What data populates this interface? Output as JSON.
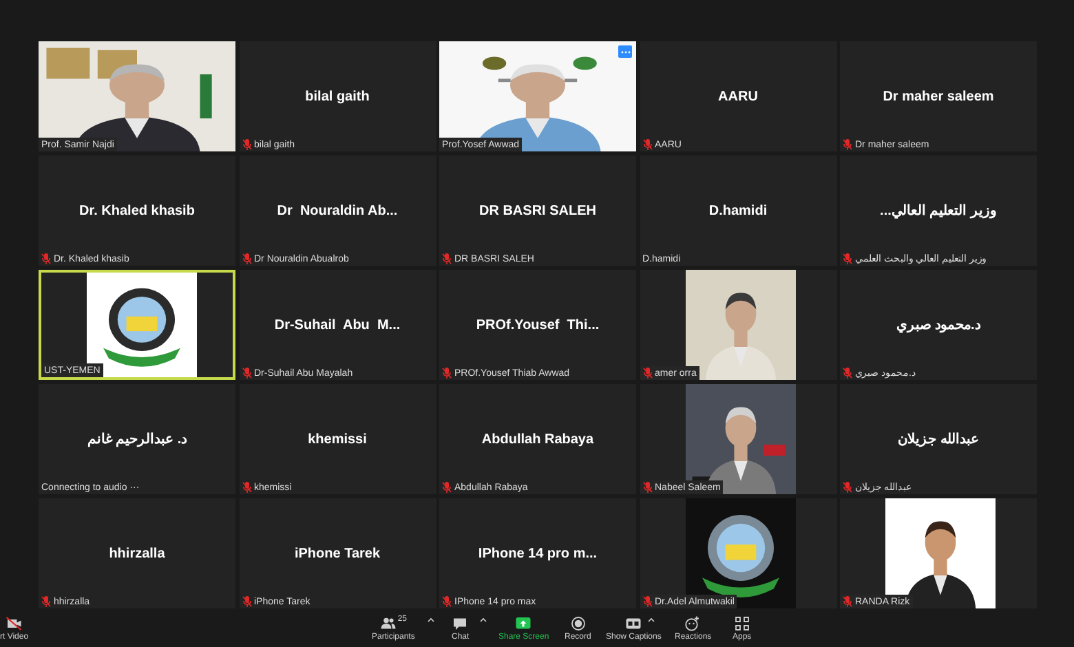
{
  "tiles": [
    {
      "kind": "video",
      "label": "Prof. Samir Najdi",
      "muted": false,
      "speaking": false
    },
    {
      "kind": "name",
      "display_name": "bilal gaith",
      "label": "bilal gaith",
      "muted": true,
      "speaking": false
    },
    {
      "kind": "video",
      "label": "Prof.Yosef Awwad",
      "muted": false,
      "speaking": false,
      "more_button": true
    },
    {
      "kind": "name",
      "display_name": "AARU",
      "label": "AARU",
      "muted": true,
      "speaking": false
    },
    {
      "kind": "name",
      "display_name": "Dr maher saleem",
      "label": "Dr maher saleem",
      "muted": true,
      "speaking": false
    },
    {
      "kind": "name",
      "display_name": "Dr. Khaled khasib",
      "label": "Dr. Khaled khasib",
      "muted": true,
      "speaking": false
    },
    {
      "kind": "name",
      "display_name": "Dr  Nouraldin Ab...",
      "label": "Dr Nouraldin Abualrob",
      "muted": true,
      "speaking": false
    },
    {
      "kind": "name",
      "display_name": "DR BASRI SALEH",
      "label": "DR BASRI SALEH",
      "muted": true,
      "speaking": false
    },
    {
      "kind": "name",
      "display_name": "D.hamidi",
      "label": "D.hamidi",
      "muted": false,
      "speaking": false
    },
    {
      "kind": "name",
      "display_name": "وزير التعليم العالي...",
      "label": "وزير التعليم العالي والبحث العلمي",
      "muted": true,
      "speaking": false
    },
    {
      "label": "UST-YEMEN",
      "muted": false,
      "speaking": true
    },
    {
      "kind": "name",
      "display_name": "Dr-Suhail  Abu  M...",
      "label": "Dr-Suhail Abu Mayalah",
      "muted": true,
      "speaking": false
    },
    {
      "kind": "name",
      "display_name": "PROf.Yousef  Thi...",
      "label": "PROf.Yousef Thiab Awwad",
      "muted": true,
      "speaking": false
    },
    {
      "label": "amer orra",
      "muted": true,
      "speaking": false
    },
    {
      "kind": "name",
      "display_name": "د.محمود صبري",
      "label": "د.محمود صبري",
      "muted": true,
      "speaking": false
    },
    {
      "kind": "name",
      "display_name": "د. عبدالرحيم غانم",
      "label": "Connecting to audio ···",
      "muted": false,
      "speaking": false
    },
    {
      "kind": "name",
      "display_name": "khemissi",
      "label": "khemissi",
      "muted": true,
      "speaking": false
    },
    {
      "kind": "name",
      "display_name": "Abdullah Rabaya",
      "label": "Abdullah Rabaya",
      "muted": true,
      "speaking": false
    },
    {
      "label": "Nabeel Saleem",
      "muted": true,
      "speaking": false
    },
    {
      "kind": "name",
      "display_name": "عبدالله جزيلان",
      "label": "عبدالله جزيلان",
      "muted": true,
      "speaking": false
    },
    {
      "kind": "name",
      "display_name": "hhirzalla",
      "label": "hhirzalla",
      "muted": true,
      "speaking": false
    },
    {
      "kind": "name",
      "display_name": "iPhone Tarek",
      "label": "iPhone Tarek",
      "muted": true,
      "speaking": false
    },
    {
      "kind": "name",
      "display_name": "IPhone 14 pro m...",
      "label": "IPhone 14 pro max",
      "muted": true,
      "speaking": false
    },
    {
      "label": "Dr.Adel Almutwakil",
      "muted": true,
      "speaking": false
    },
    {
      "label": "RANDA Rizk",
      "muted": true,
      "speaking": false
    }
  ],
  "toolbar": [
    {
      "kind": "video",
      "label": "rt Video"
    },
    {
      "kind": "participants",
      "label": "Participants",
      "count": "25",
      "caret": true
    },
    {
      "kind": "chat",
      "label": "Chat",
      "caret": true
    },
    {
      "kind": "share",
      "label": "Share Screen"
    },
    {
      "kind": "record",
      "label": "Record"
    },
    {
      "kind": "captions",
      "label": "Show Captions",
      "caret": true
    },
    {
      "kind": "reactions",
      "label": "Reactions"
    },
    {
      "kind": "apps",
      "label": "Apps"
    }
  ]
}
